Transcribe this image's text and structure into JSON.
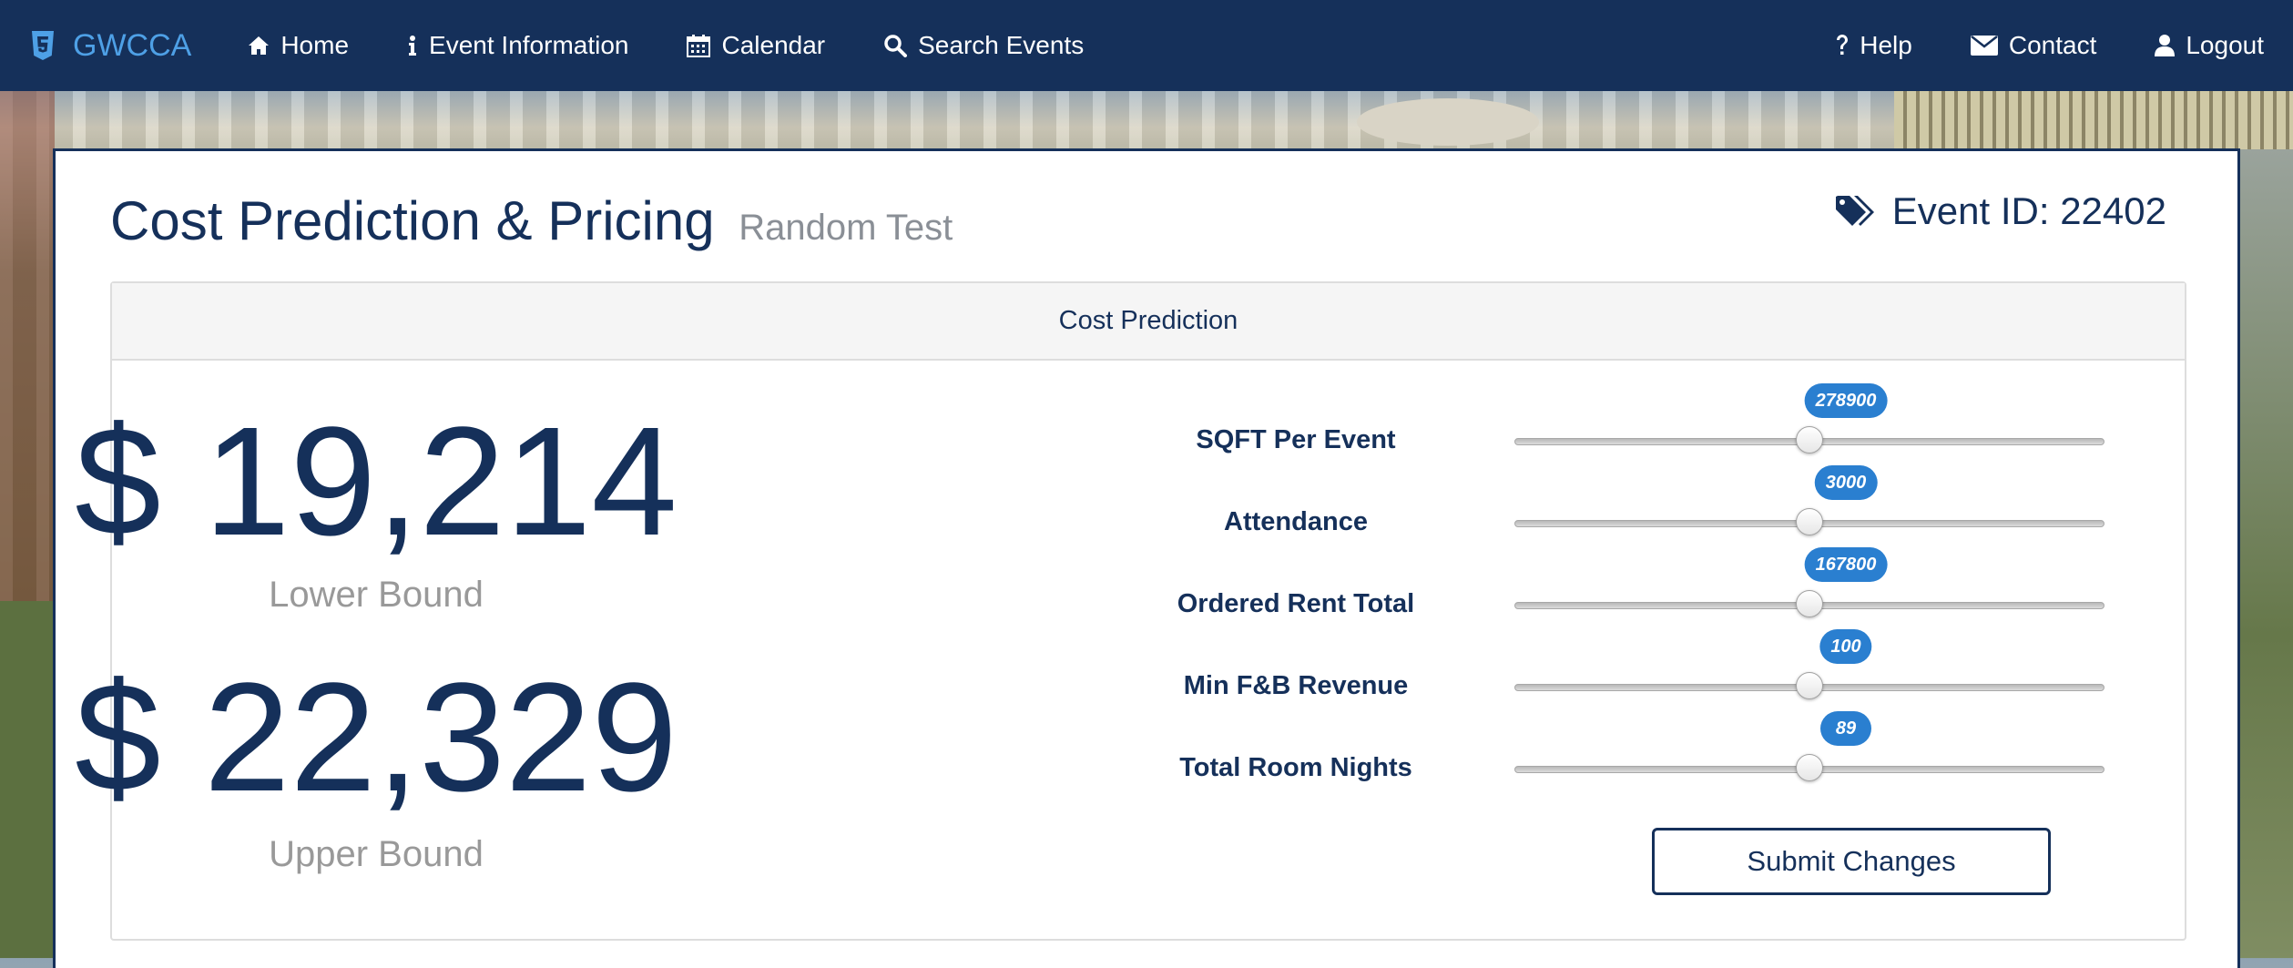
{
  "colors": {
    "navbar": "#15305a",
    "brand_accent": "#4ea0e6",
    "tooltip": "#2a7fd0",
    "muted": "#999999"
  },
  "nav": {
    "brand": {
      "icon": "html5-icon",
      "label": "GWCCA"
    },
    "items": [
      {
        "icon": "home-icon",
        "label": "Home"
      },
      {
        "icon": "info-icon",
        "label": "Event Information"
      },
      {
        "icon": "calendar-icon",
        "label": "Calendar"
      },
      {
        "icon": "search-icon",
        "label": "Search Events"
      }
    ],
    "right_items": [
      {
        "icon": "question-icon",
        "label": "Help"
      },
      {
        "icon": "envelope-icon",
        "label": "Contact"
      },
      {
        "icon": "user-icon",
        "label": "Logout"
      }
    ]
  },
  "page": {
    "title": "Cost Prediction & Pricing",
    "subtitle": "Random Test",
    "event_id": {
      "icon": "tags-icon",
      "label": "Event ID: 22402"
    }
  },
  "panel": {
    "heading": "Cost Prediction",
    "lower": {
      "value": "$ 19,214",
      "label": "Lower Bound"
    },
    "upper": {
      "value": "$ 22,329",
      "label": "Upper Bound"
    },
    "sliders": [
      {
        "label": "SQFT Per Event",
        "value": "278900",
        "fraction": 0.5
      },
      {
        "label": "Attendance",
        "value": "3000",
        "fraction": 0.5
      },
      {
        "label": "Ordered Rent Total",
        "value": "167800",
        "fraction": 0.5
      },
      {
        "label": "Min F&B Revenue",
        "value": "100",
        "fraction": 0.5
      },
      {
        "label": "Total Room Nights",
        "value": "89",
        "fraction": 0.5
      }
    ],
    "submit_label": "Submit Changes"
  }
}
